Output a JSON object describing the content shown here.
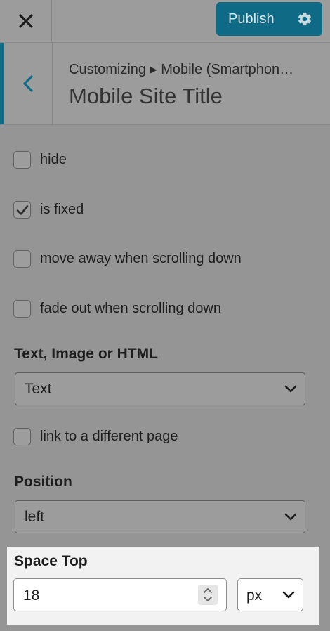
{
  "topbar": {
    "close_icon": "close-icon",
    "publish_label": "Publish",
    "settings_icon": "gear-icon",
    "accent_color": "#0f6a86"
  },
  "section": {
    "breadcrumb": "Customizing ▸ Mobile (Smartphon…",
    "title": "Mobile Site Title",
    "back_icon": "chevron-left-icon"
  },
  "options": [
    {
      "label": "hide",
      "checked": false
    },
    {
      "label": "is fixed",
      "checked": true
    },
    {
      "label": "move away when scrolling down",
      "checked": false
    },
    {
      "label": "fade out when scrolling down",
      "checked": false
    }
  ],
  "content_type": {
    "label": "Text, Image or HTML",
    "value": "Text"
  },
  "link_option": {
    "label": "link to a different page",
    "checked": false
  },
  "position": {
    "label": "Position",
    "value": "left"
  },
  "space_top": {
    "label": "Space Top",
    "value": "18",
    "unit": "px"
  }
}
